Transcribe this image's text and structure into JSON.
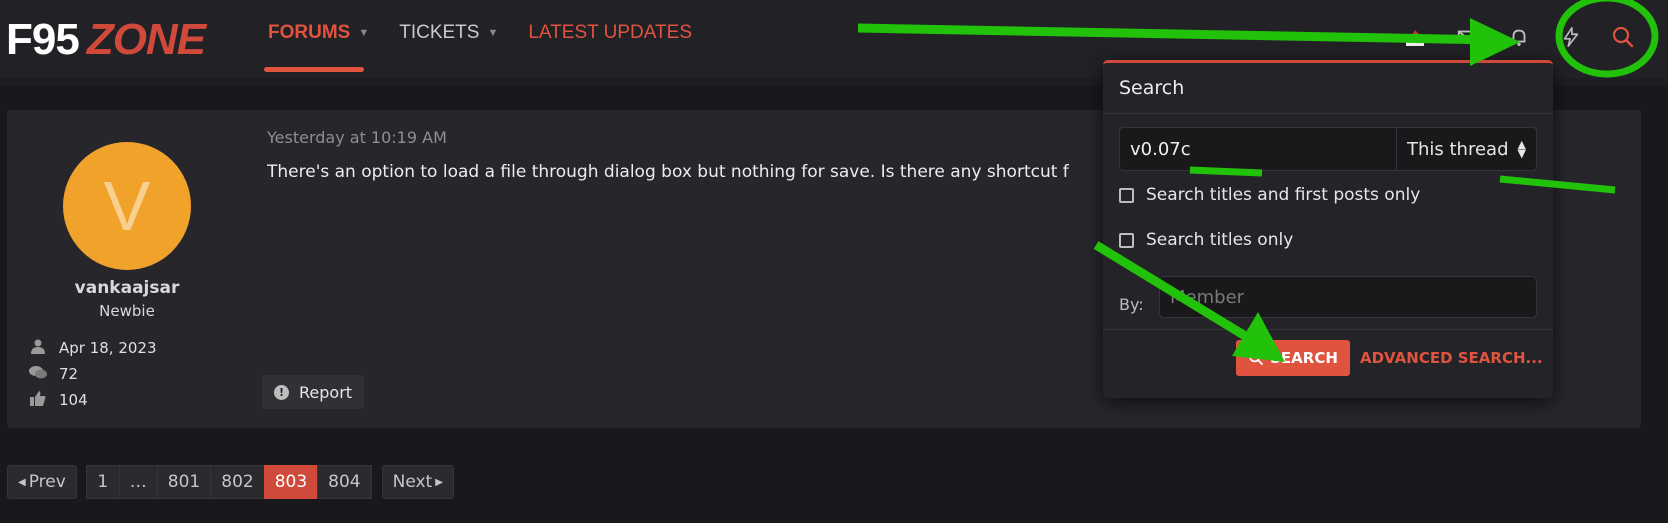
{
  "header": {
    "logo": {
      "part1": "F95",
      "part2": "ZONE"
    },
    "nav": [
      {
        "label": "FORUMS",
        "has_caret": true,
        "active": true
      },
      {
        "label": "TICKETS",
        "has_caret": true,
        "active": false
      },
      {
        "label": "LATEST UPDATES",
        "has_caret": false,
        "active": false
      }
    ],
    "icons": [
      "santa-hat-icon",
      "envelope-icon",
      "bell-icon",
      "bolt-icon",
      "search-icon"
    ]
  },
  "post": {
    "avatar_letter": "V",
    "username": "vankaajsar",
    "user_title": "Newbie",
    "joined": "Apr 18, 2023",
    "messages": "72",
    "reactions": "104",
    "date": "Yesterday at 10:19 AM",
    "body": "There's an option to load a file through dialog box but nothing for save. Is there any shortcut f",
    "report_label": "Report"
  },
  "pagination": {
    "prev": "Prev",
    "pages": [
      "1",
      "…",
      "801",
      "802",
      "803",
      "804"
    ],
    "current": "803",
    "next": "Next"
  },
  "search_panel": {
    "title": "Search",
    "query_value": "v0.07c",
    "scope": "This thread",
    "option1": "Search titles and first posts only",
    "option2": "Search titles only",
    "by_label": "By:",
    "member_placeholder": "Member",
    "search_button": "SEARCH",
    "advanced_link": "ADVANCED SEARCH..."
  },
  "colors": {
    "accent": "#e0533f",
    "annotation": "#22c10a",
    "avatar": "#f1a22b"
  }
}
